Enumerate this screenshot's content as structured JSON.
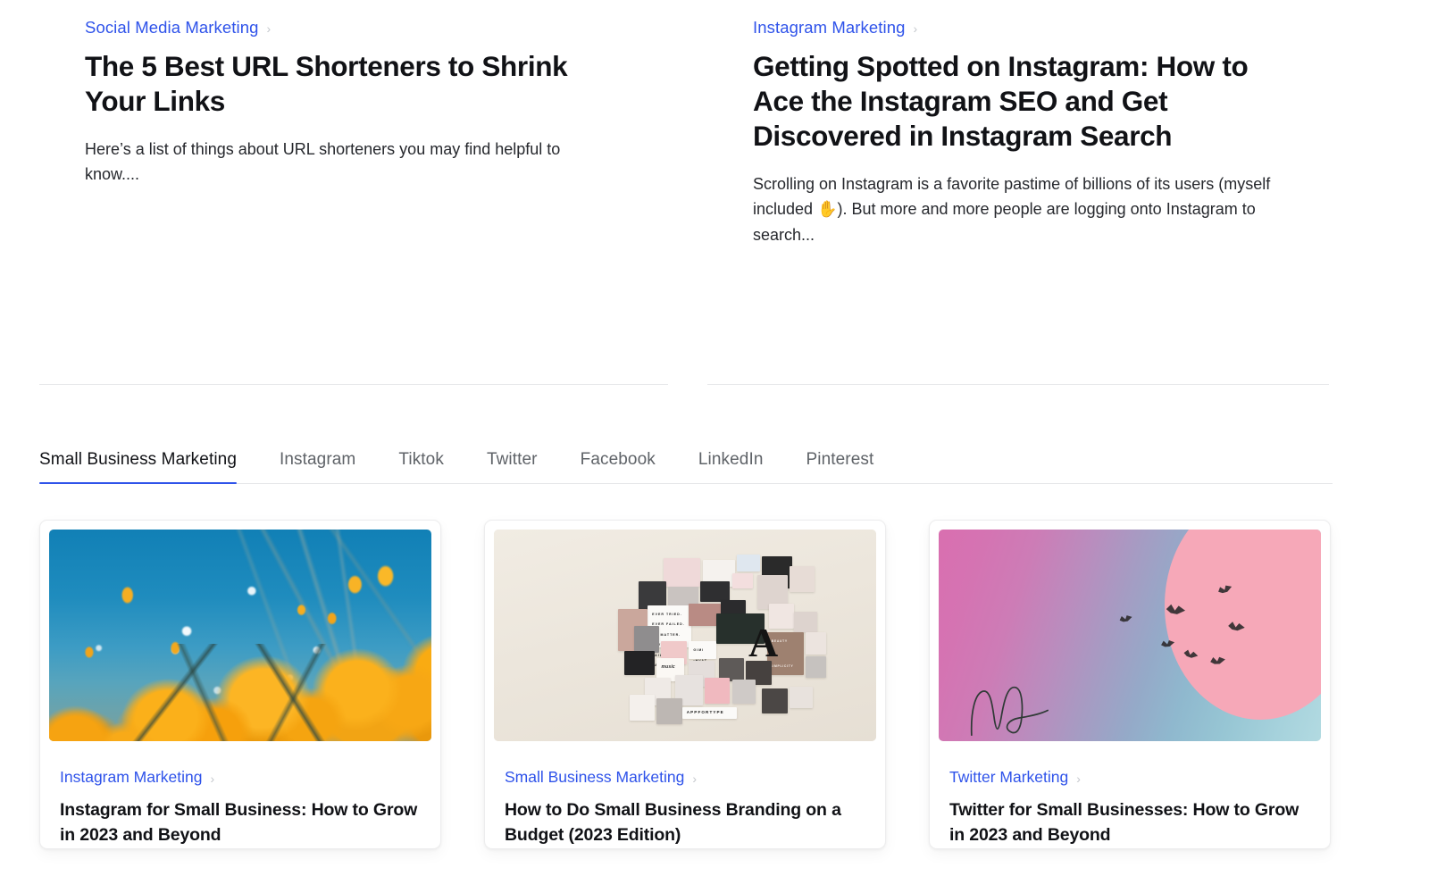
{
  "featured": [
    {
      "category": "Social Media Marketing",
      "chevron": "chevron-right",
      "title": "The 5 Best URL Shorteners to Shrink Your Links",
      "excerpt": "Here’s a list of things about URL shorteners you may find helpful to know...."
    },
    {
      "category": "Instagram Marketing",
      "chevron": "chevron-right",
      "title": "Getting Spotted on Instagram: How to Ace the Instagram SEO and Get Discovered in Instagram Search",
      "excerpt": "Scrolling on Instagram is a favorite pastime of billions of its users (myself included ✋). But more and more people are logging onto Instagram to search..."
    }
  ],
  "tabs": {
    "active_index": 0,
    "items": [
      {
        "label": "Small Business Marketing"
      },
      {
        "label": "Instagram"
      },
      {
        "label": "Tiktok"
      },
      {
        "label": "Twitter"
      },
      {
        "label": "Facebook"
      },
      {
        "label": "LinkedIn"
      },
      {
        "label": "Pinterest"
      }
    ]
  },
  "cards": [
    {
      "image_alt": "orange-poppy-flowers-against-blue-sky",
      "category": "Instagram Marketing",
      "title": "Instagram for Small Business: How to Grow in 2023 and Beyond"
    },
    {
      "image_alt": "pinned-photo-moodboard-collage-on-beige-wall",
      "category": "Small Business Marketing",
      "title": "How to Do Small Business Branding on a Budget (2023 Edition)"
    },
    {
      "image_alt": "birds-flying-in-pink-blue-gradient-sky",
      "category": "Twitter Marketing",
      "title": "Twitter for Small Businesses: How to Grow in 2023 and Beyond"
    }
  ],
  "moodboard": {
    "quote_lines": [
      "EVER TRIED.",
      "EVER FAILED.",
      "NO MATTER.",
      "TRY AGAIN.",
      "FAIL AGAIN.",
      "FAIL BETTER."
    ],
    "labels": [
      "APPFORTYPE",
      "music",
      "GIMI· •HVAT",
      "BEAUTY",
      "SIMPLICITY",
      "A"
    ]
  },
  "colors": {
    "link_blue": "#2f53ea",
    "tab_active_underline": "#2f53ea",
    "tab_inactive_text": "#5f6368",
    "heading_text": "#111216",
    "divider": "#e6e7e9",
    "card_border": "#ededee",
    "page_background": "#ffffff"
  }
}
